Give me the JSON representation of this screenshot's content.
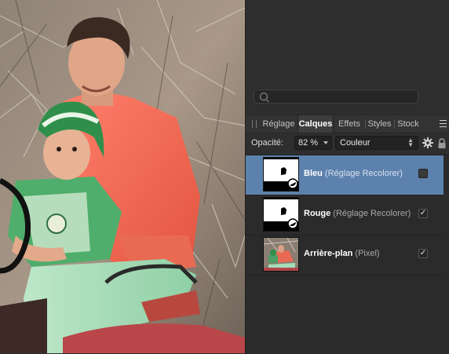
{
  "search": {
    "placeholder": "",
    "value": ""
  },
  "tabs": [
    {
      "label": "Réglage",
      "active": false
    },
    {
      "label": "Calques",
      "active": true
    },
    {
      "label": "Effets",
      "active": false
    },
    {
      "label": "Styles",
      "active": false
    },
    {
      "label": "Stock",
      "active": false
    }
  ],
  "layer_controls": {
    "opacity_label": "Opacité:",
    "opacity_value": "82 %",
    "blend_mode": "Couleur"
  },
  "layers": [
    {
      "name": "Bleu",
      "type": "(Réglage Recolorer)",
      "visible": false,
      "selected": true
    },
    {
      "name": "Rouge",
      "type": "(Réglage Recolorer)",
      "visible": true,
      "selected": false
    },
    {
      "name": "Arrière-plan",
      "type": "(Pixel)",
      "visible": true,
      "selected": false
    }
  ],
  "icons": {
    "search": "search-icon",
    "panel_menu": "hamburger-menu-icon",
    "settings": "gear-icon",
    "lock": "lock-icon",
    "panel_grip": "grip-icon"
  },
  "colors": {
    "panel_bg": "#2e2e2e",
    "selected_layer": "#5d81ad",
    "shirt": "#f06a56",
    "cap": "#2f8f4a"
  },
  "check_glyph": "✓"
}
